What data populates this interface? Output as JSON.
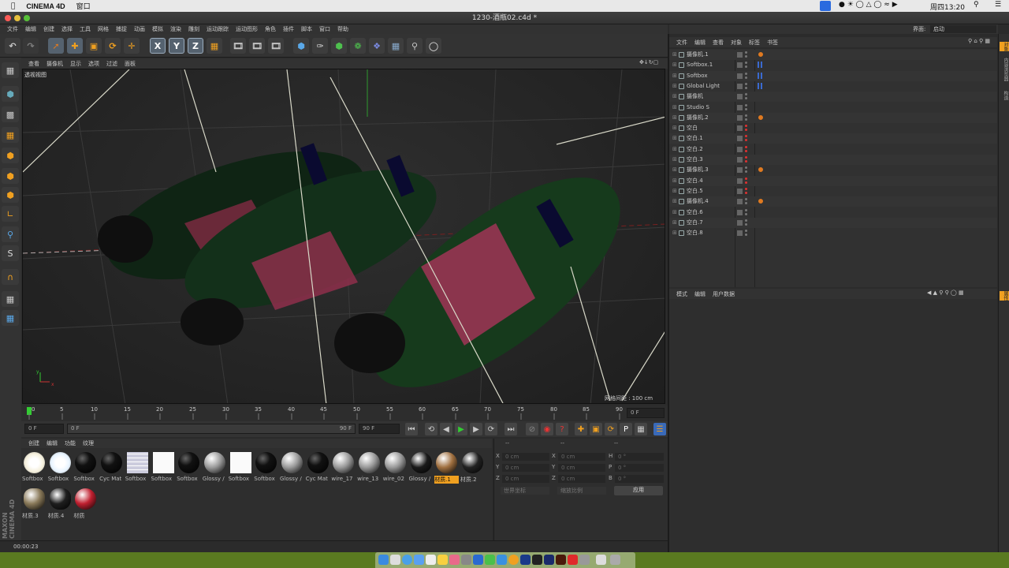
{
  "macos": {
    "app": "CINEMA 4D",
    "window_menu": "窗口",
    "clock": "周四13:20"
  },
  "window": {
    "title": "1230-酒瓶02.c4d *"
  },
  "menu": [
    "文件",
    "编辑",
    "创建",
    "选择",
    "工具",
    "网格",
    "捕捉",
    "动画",
    "模拟",
    "渲染",
    "雕刻",
    "运动跟踪",
    "运动图形",
    "角色",
    "插件",
    "脚本",
    "窗口",
    "帮助"
  ],
  "layout": {
    "label": "界面:",
    "value": "启动"
  },
  "toolbar": {
    "x": "X",
    "y": "Y",
    "z": "Z"
  },
  "viewport": {
    "menu": [
      "查看",
      "摄像机",
      "显示",
      "选项",
      "过滤",
      "面板"
    ],
    "name": "透视视图",
    "grid_info": "网格间距 : 100 cm",
    "axis_x": "x",
    "axis_y": "y"
  },
  "timeline": {
    "ticks": [
      "0",
      "5",
      "10",
      "15",
      "20",
      "25",
      "30",
      "35",
      "40",
      "45",
      "50",
      "55",
      "60",
      "65",
      "70",
      "75",
      "80",
      "85",
      "90"
    ],
    "end_field": "0 F",
    "current": "0 F",
    "range_start": "0 F",
    "range_end": "90 F",
    "max": "90 F"
  },
  "materials": {
    "menu": [
      "创建",
      "编辑",
      "功能",
      "纹理"
    ],
    "items": [
      {
        "label": "Softbox",
        "color": "#f5f0dc",
        "type": "glow"
      },
      {
        "label": "Softbox",
        "color": "#e8f4ff",
        "type": "glow"
      },
      {
        "label": "Softbox",
        "color": "#0a0a0a",
        "type": "black"
      },
      {
        "label": "Cyc Mat",
        "color": "#0a0a0a",
        "type": "black"
      },
      {
        "label": "Softbox",
        "color": "#dddddd",
        "type": "grid"
      },
      {
        "label": "Softbox",
        "color": "#ffffff",
        "type": "white"
      },
      {
        "label": "Softbox",
        "color": "#0a0a0a",
        "type": "black"
      },
      {
        "label": "Glossy /",
        "color": "#9a9a9a",
        "type": "grey"
      },
      {
        "label": "Softbox",
        "color": "#ffffff",
        "type": "white"
      },
      {
        "label": "Softbox",
        "color": "#0a0a0a",
        "type": "black"
      },
      {
        "label": "Glossy /",
        "color": "#9a9a9a",
        "type": "grey"
      },
      {
        "label": "Cyc Mat",
        "color": "#111111",
        "type": "black"
      },
      {
        "label": "wire_17",
        "color": "#999999",
        "type": "grey"
      },
      {
        "label": "wire_13",
        "color": "#999999",
        "type": "grey"
      },
      {
        "label": "wire_02",
        "color": "#999999",
        "type": "grey"
      },
      {
        "label": "Glossy /",
        "color": "#1a1a1a",
        "type": "dark"
      },
      {
        "label": "材质.1",
        "color": "#a07040",
        "type": "wood",
        "selected": true
      },
      {
        "label": "材质.2",
        "color": "#222222",
        "type": "label"
      },
      {
        "label": "材质.3",
        "color": "#8a7a5a",
        "type": "bottle"
      },
      {
        "label": "材质.4",
        "color": "#1e1e1e",
        "type": "bottle2"
      },
      {
        "label": "材质",
        "color": "#c02030",
        "type": "red"
      }
    ]
  },
  "coords": {
    "header": [
      "--",
      "--",
      "--"
    ],
    "rows": [
      {
        "a": "X",
        "av": "0 cm",
        "b": "X",
        "bv": "0 cm",
        "c": "H",
        "cv": "0 °"
      },
      {
        "a": "Y",
        "av": "0 cm",
        "b": "Y",
        "bv": "0 cm",
        "c": "P",
        "cv": "0 °"
      },
      {
        "a": "Z",
        "av": "0 cm",
        "b": "Z",
        "bv": "0 cm",
        "c": "B",
        "cv": "0 °"
      }
    ],
    "world": "世界坐标",
    "scale": "缩放比例",
    "apply": "应用"
  },
  "status": {
    "time": "00:00:23"
  },
  "objects": {
    "menu": [
      "文件",
      "编辑",
      "查看",
      "对象",
      "标签",
      "书签"
    ],
    "rows": [
      {
        "name": "摄像机.1",
        "kind": "camera",
        "tag": "orange"
      },
      {
        "name": "Softbox.1",
        "kind": "null",
        "tag": "dots"
      },
      {
        "name": "Softbox",
        "kind": "null",
        "tag": "dots"
      },
      {
        "name": "Global Light",
        "kind": "null",
        "tag": "dots"
      },
      {
        "name": "摄像机",
        "kind": "camera",
        "tag": "grey"
      },
      {
        "name": "Studio S",
        "kind": "null",
        "tag": ""
      },
      {
        "name": "摄像机.2",
        "kind": "camera",
        "tag": "orange"
      },
      {
        "name": "空白",
        "kind": "null",
        "tag": "red"
      },
      {
        "name": "空白.1",
        "kind": "null",
        "tag": "red"
      },
      {
        "name": "空白.2",
        "kind": "null",
        "tag": "red"
      },
      {
        "name": "空白.3",
        "kind": "null",
        "tag": "red"
      },
      {
        "name": "摄像机.3",
        "kind": "camera",
        "tag": "orange"
      },
      {
        "name": "空白.4",
        "kind": "null",
        "tag": "red"
      },
      {
        "name": "空白.5",
        "kind": "null",
        "tag": "red"
      },
      {
        "name": "摄像机.4",
        "kind": "camera",
        "tag": "orange"
      },
      {
        "name": "空白.6",
        "kind": "null",
        "tag": "grey"
      },
      {
        "name": "空白.7",
        "kind": "null",
        "tag": "grey"
      },
      {
        "name": "空白.8",
        "kind": "null",
        "tag": "grey"
      }
    ]
  },
  "attributes": {
    "menu": [
      "模式",
      "编辑",
      "用户数据"
    ]
  },
  "right_tabs": [
    "对象",
    "内容浏览器",
    "构造",
    "属性"
  ],
  "maxon": {
    "line1": "MAXON",
    "line2": "CINEMA 4D"
  }
}
